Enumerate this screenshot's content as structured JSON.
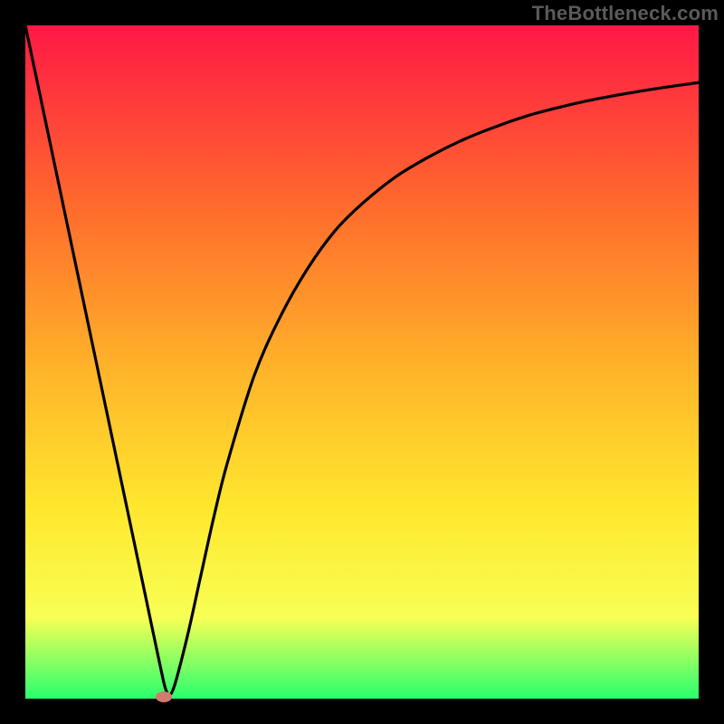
{
  "watermark": "TheBottleneck.com",
  "gradient": {
    "top": "#ff1846",
    "mid1": "#ff6e2c",
    "mid2": "#ffb62a",
    "mid3": "#ffe82e",
    "mid4": "#f7ff55",
    "bottom": "#28ff6e"
  },
  "chart_data": {
    "type": "line",
    "title": "",
    "xlabel": "",
    "ylabel": "",
    "xlim": [
      0,
      100
    ],
    "ylim": [
      0,
      100
    ],
    "grid": false,
    "legend": false,
    "series": [
      {
        "name": "bottleneck-curve",
        "x": [
          0,
          2,
          4,
          6,
          8,
          10,
          12,
          14,
          16,
          18,
          20,
          21,
          22,
          24,
          26,
          28,
          30,
          34,
          38,
          42,
          46,
          50,
          55,
          60,
          65,
          70,
          75,
          80,
          85,
          90,
          95,
          100
        ],
        "y": [
          100,
          90.5,
          81,
          71.5,
          62,
          52.5,
          43,
          33.5,
          24,
          14.5,
          5,
          1,
          1.5,
          9,
          18,
          27,
          35,
          48,
          57,
          64,
          69.5,
          73.5,
          77.5,
          80.5,
          83,
          85,
          86.7,
          88,
          89.1,
          90,
          90.8,
          91.5
        ],
        "color": "#000000",
        "width": 3.2
      }
    ],
    "marker": {
      "x": 20.5,
      "y": 0.3,
      "color": "#d17a6f"
    }
  }
}
